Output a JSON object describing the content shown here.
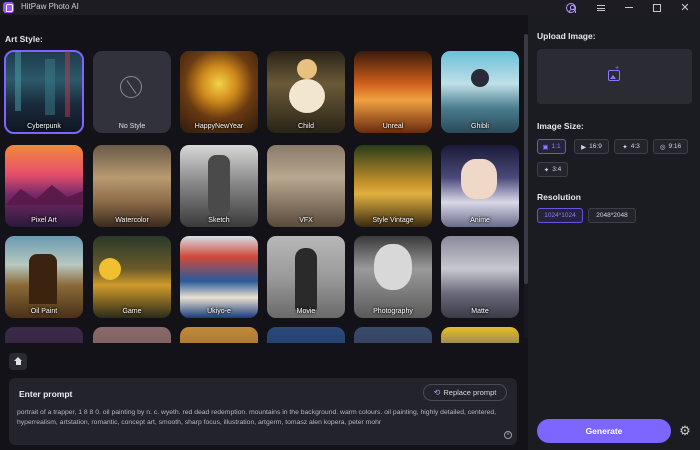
{
  "app": {
    "title": "HitPaw Photo AI"
  },
  "left": {
    "art_style_label": "Art Style:",
    "styles": [
      {
        "label": "Cyberpunk",
        "selected": true
      },
      {
        "label": "No Style"
      },
      {
        "label": "HappyNewYear"
      },
      {
        "label": "Child"
      },
      {
        "label": "Unreal"
      },
      {
        "label": "Ghibli"
      },
      {
        "label": "Pixel Art"
      },
      {
        "label": "Watercolor"
      },
      {
        "label": "Sketch"
      },
      {
        "label": "VFX"
      },
      {
        "label": "Style Vintage"
      },
      {
        "label": "Anime"
      },
      {
        "label": "Oil Paint"
      },
      {
        "label": "Game"
      },
      {
        "label": "Ukiyo-e"
      },
      {
        "label": "Movie"
      },
      {
        "label": "Photography"
      },
      {
        "label": "Matte"
      }
    ]
  },
  "prompt": {
    "title": "Enter prompt",
    "replace_label": "Replace prompt",
    "text": "portrait of a trapper, 1 8 8 0. oil painting by n. c. wyeth. red dead redemption. mountains in the background. warm colours. oil painting, highly detailed, centered, hyperrealism, artstation, romantic, concept art, smooth, sharp focus, illustration, artgerm, tomasz alen kopera, peter mohr"
  },
  "right": {
    "upload_label": "Upload Image:",
    "size_label": "Image Size:",
    "sizes": [
      "1:1",
      "16:9",
      "4:3",
      "9:16",
      "3:4"
    ],
    "resolution_label": "Resolution",
    "resolutions": [
      "1024*1024",
      "2048*2048"
    ],
    "generate_label": "Generate"
  },
  "colors": {
    "accent": "#7c66ff",
    "background": "#121218",
    "panel": "#1b1b22"
  }
}
